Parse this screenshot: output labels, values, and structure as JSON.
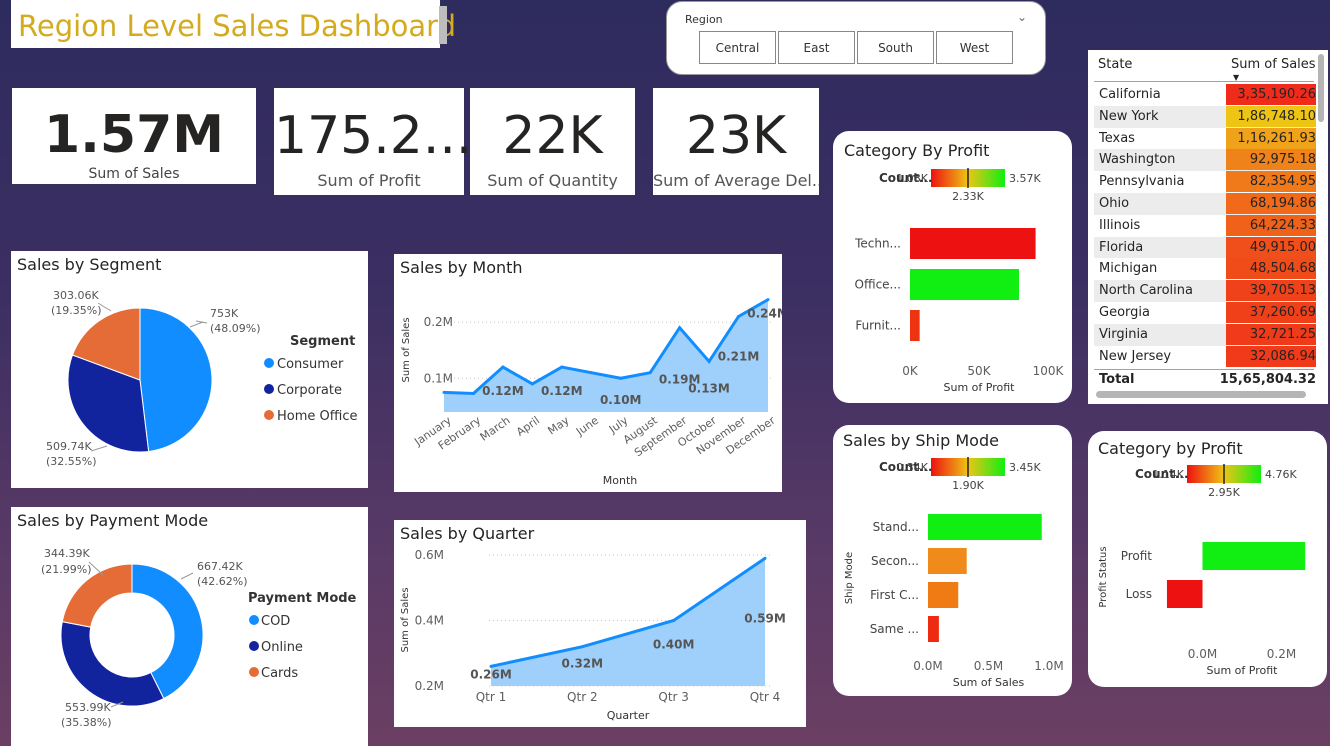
{
  "title": "Region Level Sales Dashboard",
  "slicer": {
    "label": "Region",
    "options": [
      "Central",
      "East",
      "South",
      "West"
    ]
  },
  "kpis": {
    "sales": {
      "value": "1.57M",
      "label": "Sum of Sales"
    },
    "profit": {
      "value": "175.2...",
      "label": "Sum of Profit"
    },
    "quantity": {
      "value": "22K",
      "label": "Sum of Quantity"
    },
    "delivery": {
      "value": "23K",
      "label": "Sum of Average Del..."
    }
  },
  "segment": {
    "title": "Sales by Segment",
    "legend_title": "Segment",
    "chart_data": {
      "type": "pie",
      "labels": [
        "Consumer",
        "Corporate",
        "Home Office"
      ],
      "values": [
        753000,
        509740,
        303060
      ],
      "percents": [
        48.09,
        32.55,
        19.35
      ],
      "colors": [
        "#118dff",
        "#12239e",
        "#e66c37"
      ],
      "value_labels": [
        "753K",
        "509.74K",
        "303.06K"
      ],
      "pct_labels": [
        "(48.09%)",
        "(32.55%)",
        "(19.35%)"
      ]
    }
  },
  "payment": {
    "title": "Sales by Payment Mode",
    "legend_title": "Payment Mode",
    "chart_data": {
      "type": "pie",
      "labels": [
        "COD",
        "Online",
        "Cards"
      ],
      "values": [
        667420,
        553990,
        344390
      ],
      "percents": [
        42.62,
        35.38,
        21.99
      ],
      "colors": [
        "#118dff",
        "#12239e",
        "#e66c37"
      ],
      "value_labels": [
        "667.42K",
        "553.99K",
        "344.39K"
      ],
      "pct_labels": [
        "(42.62%)",
        "(35.38%)",
        "(21.99%)"
      ]
    }
  },
  "month": {
    "title": "Sales by Month",
    "chart_data": {
      "type": "area",
      "categories": [
        "January",
        "February",
        "March",
        "April",
        "May",
        "June",
        "July",
        "August",
        "September",
        "October",
        "November",
        "December"
      ],
      "values": [
        0.075,
        0.073,
        0.12,
        0.09,
        0.12,
        0.11,
        0.1,
        0.11,
        0.19,
        0.13,
        0.21,
        0.24
      ],
      "data_labels": [
        "",
        "",
        "0.12M",
        "",
        "0.12M",
        "",
        "0.10M",
        "",
        "0.19M",
        "0.13M",
        "0.21M",
        "0.24M"
      ],
      "xlabel": "Month",
      "ylabel": "Sum of Sales",
      "yticks": [
        "0.1M",
        "0.2M"
      ],
      "ytick_values": [
        0.1,
        0.2
      ],
      "ylim": [
        0.04,
        0.25
      ]
    }
  },
  "quarter": {
    "title": "Sales by Quarter",
    "chart_data": {
      "type": "area",
      "categories": [
        "Qtr 1",
        "Qtr 2",
        "Qtr 3",
        "Qtr 4"
      ],
      "values": [
        0.26,
        0.32,
        0.4,
        0.59
      ],
      "data_labels": [
        "0.26M",
        "0.32M",
        "0.40M",
        "0.59M"
      ],
      "xlabel": "Quarter",
      "ylabel": "Sum of Sales",
      "yticks": [
        "0.2M",
        "0.4M",
        "0.6M"
      ],
      "ytick_values": [
        0.2,
        0.4,
        0.6
      ],
      "ylim": [
        0.2,
        0.6
      ]
    }
  },
  "cat_profit": {
    "title": "Category By Profit",
    "legend": {
      "label": "Count...",
      "min": "1.08K",
      "mid": "2.33K",
      "max": "3.57K"
    },
    "chart_data": {
      "type": "bar",
      "categories": [
        "Techn...",
        "Office...",
        "Furnit..."
      ],
      "values": [
        91000,
        79000,
        7000
      ],
      "colors": [
        "#ee1111",
        "#11ee11",
        "#ee3311"
      ],
      "xlabel": "Sum of Profit",
      "xticks": [
        "0K",
        "50K",
        "100K"
      ],
      "xtick_values": [
        0,
        50000,
        100000
      ],
      "xlim": [
        0,
        100000
      ]
    }
  },
  "ship": {
    "title": "Sales by Ship Mode",
    "legend": {
      "label": "Count...",
      "min": "0.34K",
      "mid": "1.90K",
      "max": "3.45K"
    },
    "chart_data": {
      "type": "bar",
      "categories": [
        "Stand...",
        "Secon...",
        "First C...",
        "Same ..."
      ],
      "values": [
        0.94,
        0.32,
        0.25,
        0.09
      ],
      "colors": [
        "#11ee11",
        "#f08a1a",
        "#f07a14",
        "#ee2a11"
      ],
      "xlabel": "Sum of Sales",
      "ylabel": "Ship Mode",
      "xticks": [
        "0.0M",
        "0.5M",
        "1.0M"
      ],
      "xtick_values": [
        0,
        0.5,
        1.0
      ],
      "xlim": [
        0,
        1.0
      ]
    }
  },
  "cat_profit2": {
    "title": "Category by Profit",
    "legend": {
      "label": "Count...",
      "min": "1.14K",
      "mid": "2.95K",
      "max": "4.76K"
    },
    "chart_data": {
      "type": "bar",
      "categories": [
        "Profit",
        "Loss"
      ],
      "values": [
        0.26,
        -0.09
      ],
      "colors": [
        "#11ee11",
        "#ee1111"
      ],
      "xlabel": "Sum of Profit",
      "ylabel": "Profit Status",
      "xticks": [
        "0.0M",
        "0.2M"
      ],
      "xtick_values": [
        0,
        0.2
      ],
      "xlim": [
        -0.1,
        0.3
      ]
    }
  },
  "state_table": {
    "headers": [
      "State",
      "Sum of Sales"
    ],
    "rows": [
      {
        "state": "California",
        "sales": "3,35,190.26",
        "color": "#f02b1b"
      },
      {
        "state": "New York",
        "sales": "1,86,748.10",
        "color": "#eec515"
      },
      {
        "state": "Texas",
        "sales": "1,16,261.93",
        "color": "#f0a21a"
      },
      {
        "state": "Washington",
        "sales": "92,975.18",
        "color": "#f0821a"
      },
      {
        "state": "Pennsylvania",
        "sales": "82,354.95",
        "color": "#f07a1a"
      },
      {
        "state": "Ohio",
        "sales": "68,194.86",
        "color": "#f06a1a"
      },
      {
        "state": "Illinois",
        "sales": "64,224.33",
        "color": "#f0621a"
      },
      {
        "state": "Florida",
        "sales": "49,915.00",
        "color": "#f04e1a"
      },
      {
        "state": "Michigan",
        "sales": "48,504.68",
        "color": "#f04c1a"
      },
      {
        "state": "North Carolina",
        "sales": "39,705.13",
        "color": "#f0421a"
      },
      {
        "state": "Georgia",
        "sales": "37,260.69",
        "color": "#f0401a"
      },
      {
        "state": "Virginia",
        "sales": "32,721.25",
        "color": "#f03b1a"
      },
      {
        "state": "New Jersey",
        "sales": "32,086.94",
        "color": "#f03a1a"
      }
    ],
    "total_label": "Total",
    "total_value": "15,65,804.32"
  }
}
